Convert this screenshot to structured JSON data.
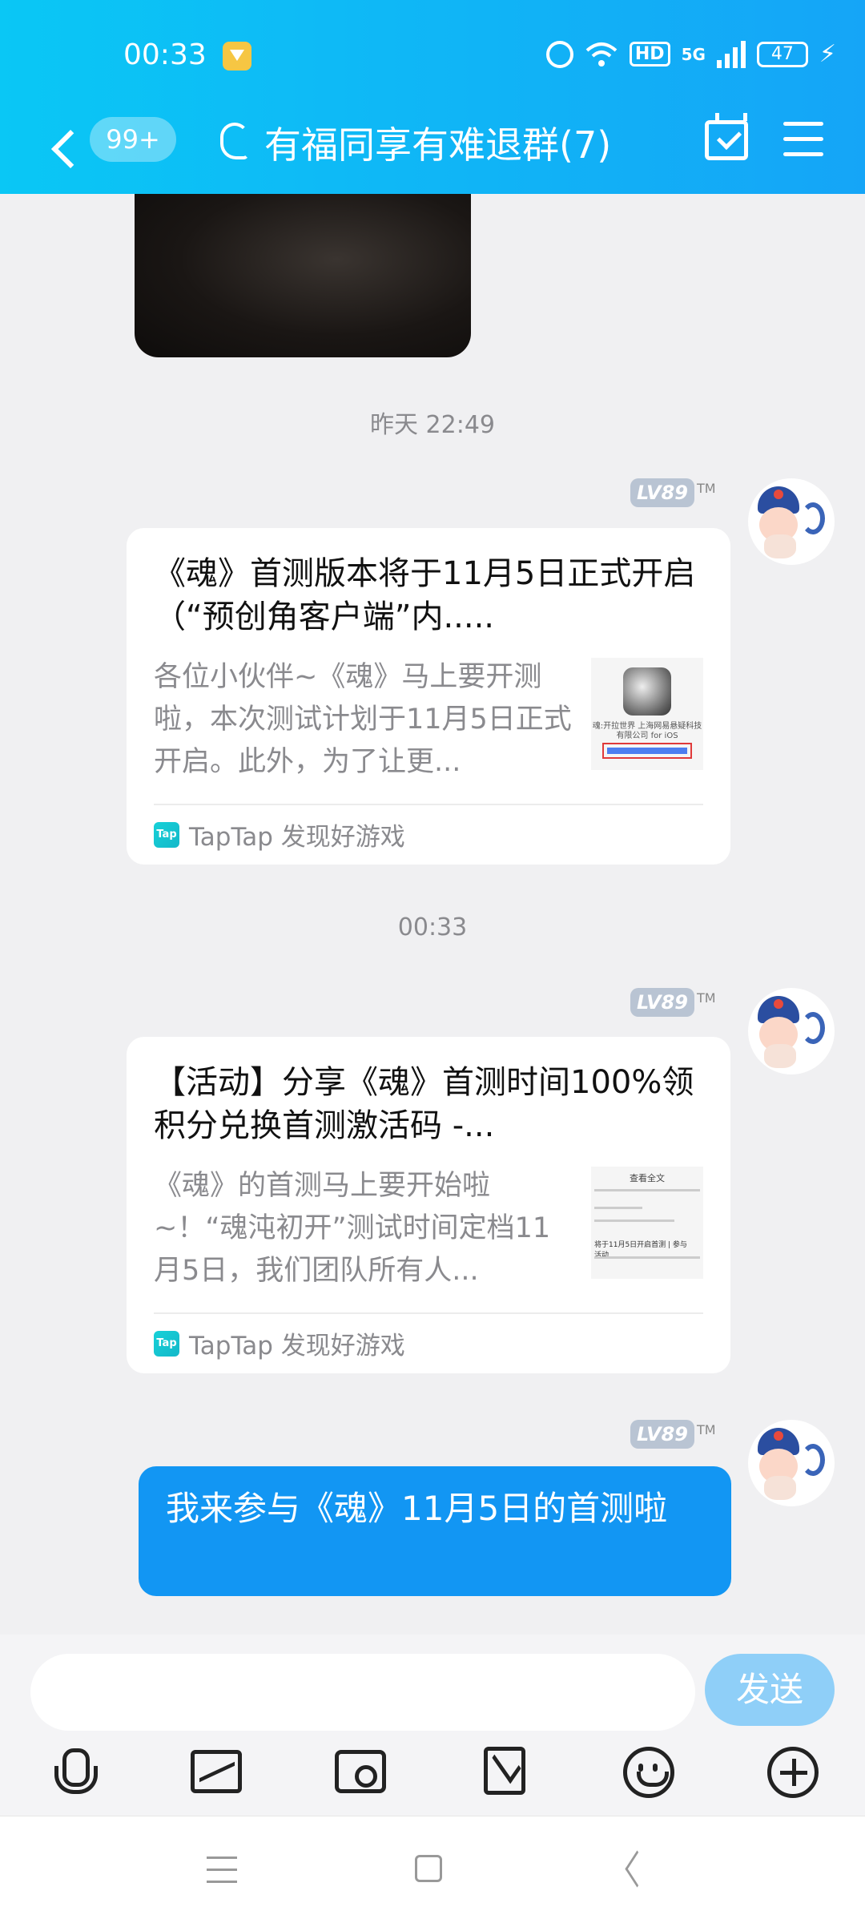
{
  "status_bar": {
    "time": "00:33",
    "network_label": "HD",
    "network_gen": "5G",
    "battery": "47"
  },
  "header": {
    "unread_count": "99+",
    "title": "有福同享有难退群(7)"
  },
  "messages": [
    {
      "timestamp": "昨天 22:49",
      "level_badge": "LV89",
      "tm": "TM",
      "card": {
        "title": "《魂》首测版本将于11月5日正式开启（“预创角客户端”内.....",
        "description": "各位小伙伴~《魂》马上要开测啦，本次测试计划于11月5日正式开启。此外，为了让更...",
        "thumb_text": "魂:开拉世界 上海网易悬疑科技有限公司 for iOS",
        "source_icon": "Tap",
        "source": "TapTap 发现好游戏"
      }
    },
    {
      "timestamp": "00:33",
      "level_badge": "LV89",
      "tm": "TM",
      "card": {
        "title": "【活动】分享《魂》首测时间100%领积分兑换首测激活码 -...",
        "description": "《魂》的首测马上要开始啦~！“魂沌初开”测试时间定档11月5日，我们团队所有人...",
        "thumb_heading": "查看全文",
        "thumb_text": "将于11月5日开启首测 | 参与活动",
        "source_icon": "Tap",
        "source": "TapTap 发现好游戏"
      }
    },
    {
      "level_badge": "LV89",
      "tm": "TM",
      "text": "我来参与《魂》11月5日的首测啦"
    }
  ],
  "input_bar": {
    "placeholder": "",
    "send_label": "发送"
  },
  "colors": {
    "header_gradient_start": "#0ac7f5",
    "header_gradient_end": "#15a5f7",
    "my_bubble": "#1296f3",
    "send_button": "#8fcff8",
    "level_badge": "#b9c4d3"
  },
  "icons": [
    "back-arrow-icon",
    "ear-icon",
    "calendar-check-icon",
    "menu-icon",
    "mic-icon",
    "image-icon",
    "camera-icon",
    "red-packet-icon",
    "emoji-icon",
    "plus-icon"
  ]
}
